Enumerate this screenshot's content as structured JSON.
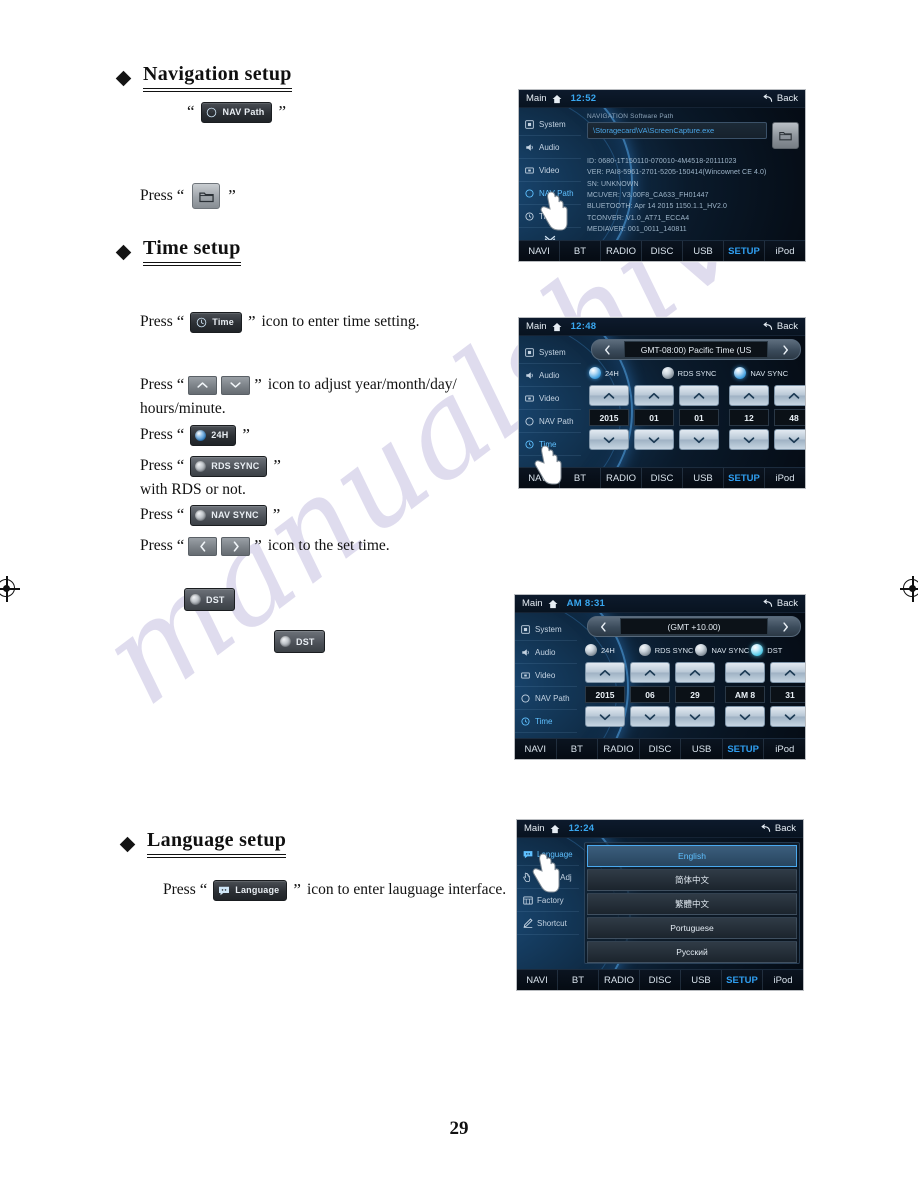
{
  "page": {
    "number": "29",
    "watermark": "manualshive"
  },
  "sections": {
    "navigation": {
      "title": "Navigation setup",
      "line1": {
        "open_quote": "“",
        "chip_label": "NAV Path",
        "chip_icon": "compass-icon",
        "close_quote": "”"
      },
      "line2": {
        "press": "Press",
        "open_quote": "“",
        "button_icon": "folder-icon",
        "close_quote": "”"
      }
    },
    "time": {
      "title": "Time setup",
      "line_time": {
        "press": "Press",
        "open_quote": "“",
        "chip_label": "Time",
        "chip_icon": "clock-icon",
        "close_quote": "”",
        "tail": "icon to enter time setting."
      },
      "line_updown": {
        "press": "Press",
        "open_quote": "“",
        "up_icon": "chevron-up-icon",
        "down_icon": "chevron-down-icon",
        "close_quote": "”",
        "tail": "icon to adjust year/month/day/",
        "tail2": "hours/minute."
      },
      "line_24h": {
        "press": "Press",
        "open_quote": "“",
        "chip_label": "24H",
        "close_quote": "”"
      },
      "line_rds": {
        "press": "Press",
        "open_quote": "“",
        "chip_label": "RDS SYNC",
        "close_quote": "”",
        "tail": "with RDS or not."
      },
      "line_navsync": {
        "press": "Press",
        "open_quote": "“",
        "chip_label": "NAV SYNC",
        "close_quote": "”"
      },
      "line_leftright": {
        "press": "Press",
        "open_quote": "“",
        "left_icon": "chevron-left-icon",
        "right_icon": "chevron-right-icon",
        "close_quote": "”",
        "tail": "icon to the set time."
      },
      "dst_chip_a": "DST",
      "dst_chip_b": "DST"
    },
    "language": {
      "title": "Language setup",
      "line1": {
        "press": "Press",
        "open_quote": "“",
        "chip_label": "Language",
        "chip_icon": "speech-bubble-icon",
        "close_quote": "”",
        "tail": "icon to enter lauguage  interface."
      }
    }
  },
  "bottom_nav": [
    "NAVI",
    "BT",
    "RADIO",
    "DISC",
    "USB",
    "SETUP",
    "iPod"
  ],
  "bottom_nav_active": "SETUP",
  "devices": {
    "system_info": {
      "header": {
        "main": "Main",
        "clock": "12:52",
        "back": "Back"
      },
      "sidebar": [
        {
          "label": "System",
          "icon": "system-icon",
          "active": false
        },
        {
          "label": "Audio",
          "icon": "speaker-icon",
          "active": false
        },
        {
          "label": "Video",
          "icon": "video-icon",
          "active": false
        },
        {
          "label": "NAV Path",
          "icon": "compass-icon",
          "active": true
        },
        {
          "label": "Time",
          "icon": "clock-icon",
          "active": false
        }
      ],
      "sidebar_chevron": "chevron-down-icon",
      "field_label": "NAVIGATION Software Path",
      "field_value": "\\Storagecard\\VA\\ScreenCapture.exe",
      "browse_icon": "folder-icon",
      "info_lines": [
        "ID: 0680-1T150110-070010-4M4518-20111023",
        "VER: PAI8-5961-2701-5205-150414(Wincownet CE 4.0)",
        "SN: UNKNOWN",
        "MCUVER: V3.00F8_CA633_FH01447",
        "BLUETOOTH: Apr 14 2015 1150.1.1_HV2.0",
        "TCONVER: V1.0_AT71_ECCA4",
        "MEDIAVER: 001_0011_140811"
      ]
    },
    "time_setup": {
      "header": {
        "main": "Main",
        "clock": "12:48",
        "back": "Back"
      },
      "sidebar": [
        {
          "label": "System",
          "icon": "system-icon",
          "active": false
        },
        {
          "label": "Audio",
          "icon": "speaker-icon",
          "active": false
        },
        {
          "label": "Video",
          "icon": "video-icon",
          "active": false
        },
        {
          "label": "NAV Path",
          "icon": "compass-icon",
          "active": false
        },
        {
          "label": "Time",
          "icon": "clock-icon",
          "active": true
        }
      ],
      "sidebar_chevron": "chevron-down-icon",
      "timezone": "GMT-08:00) Pacific Time (US",
      "tz_prev_icon": "chevron-left-icon",
      "tz_next_icon": "chevron-right-icon",
      "toggles": [
        {
          "label": "24H",
          "on": true
        },
        {
          "label": "RDS SYNC",
          "on": false
        },
        {
          "label": "NAV SYNC",
          "on": true
        }
      ],
      "spinners": [
        {
          "name": "year",
          "value": "2015"
        },
        {
          "name": "month",
          "value": "01"
        },
        {
          "name": "day",
          "value": "01"
        },
        {
          "name": "hour",
          "value": "12"
        },
        {
          "name": "minute",
          "value": "48"
        }
      ]
    },
    "dst_setup": {
      "header": {
        "main": "Main",
        "clock": "AM 8:31",
        "back": "Back"
      },
      "sidebar": [
        {
          "label": "System",
          "icon": "system-icon",
          "active": false
        },
        {
          "label": "Audio",
          "icon": "speaker-icon",
          "active": false
        },
        {
          "label": "Video",
          "icon": "video-icon",
          "active": false
        },
        {
          "label": "NAV Path",
          "icon": "compass-icon",
          "active": false
        },
        {
          "label": "Time",
          "icon": "clock-icon",
          "active": true
        }
      ],
      "sidebar_chevron": "chevron-down-icon",
      "timezone": "(GMT +10.00)",
      "tz_prev_icon": "chevron-left-icon",
      "tz_next_icon": "chevron-right-icon",
      "toggles": [
        {
          "label": "24H",
          "on": false
        },
        {
          "label": "RDS SYNC",
          "on": false
        },
        {
          "label": "NAV SYNC",
          "on": false
        },
        {
          "label": "DST",
          "on": true
        }
      ],
      "spinners": [
        {
          "name": "year",
          "value": "2015"
        },
        {
          "name": "month",
          "value": "06"
        },
        {
          "name": "day",
          "value": "29"
        },
        {
          "name": "hour",
          "value": "AM 8"
        },
        {
          "name": "minute",
          "value": "31"
        }
      ]
    },
    "language_setup": {
      "header": {
        "main": "Main",
        "clock": "12:24",
        "back": "Back"
      },
      "sidebar": [
        {
          "label": "Language",
          "icon": "speech-bubble-icon",
          "active": true
        },
        {
          "label": "Touch Adj",
          "icon": "touch-icon",
          "active": false
        },
        {
          "label": "Factory",
          "icon": "factory-icon",
          "active": false
        },
        {
          "label": "Shortcut",
          "icon": "pencil-icon",
          "active": false
        }
      ],
      "sidebar_chevron": "chevron-up-icon",
      "languages": [
        {
          "label": "English",
          "selected": true
        },
        {
          "label": "简体中文",
          "selected": false
        },
        {
          "label": "繁體中文",
          "selected": false
        },
        {
          "label": "Portuguese",
          "selected": false
        },
        {
          "label": "Русский",
          "selected": false
        }
      ]
    }
  },
  "colors": {
    "accent_blue": "#2f9ef0",
    "active_cyan": "#5fc0ff",
    "device_bg": "#0a1a2b",
    "watermark": "#968cc8"
  }
}
